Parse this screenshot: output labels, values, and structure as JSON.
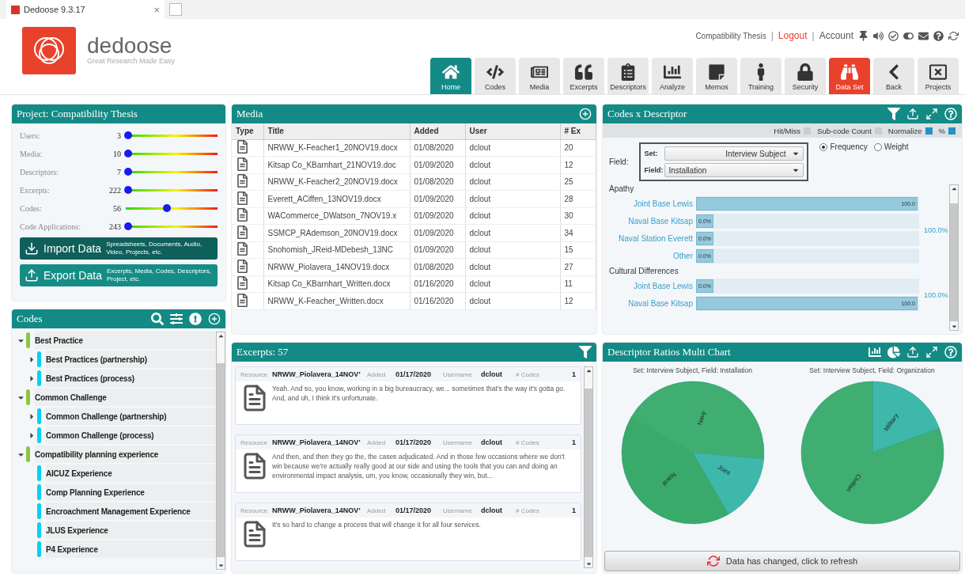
{
  "browser_tab": {
    "title": "Dedoose 9.3.17",
    "close": "×"
  },
  "logo": {
    "name": "dedoose",
    "tagline": "Great Research Made Easy"
  },
  "header_links": [
    {
      "label": "Compatibility Thesis",
      "kind": "text"
    },
    {
      "label": "|",
      "kind": "separator"
    },
    {
      "label": "Logout",
      "kind": "alert"
    },
    {
      "label": "|",
      "kind": "separator"
    },
    {
      "label": "Account",
      "kind": "link"
    }
  ],
  "nav": [
    {
      "label": "Home",
      "selected": true,
      "highlighted": false
    },
    {
      "label": "Codes",
      "selected": false,
      "highlighted": false
    },
    {
      "label": "Media",
      "selected": false,
      "highlighted": false
    },
    {
      "label": "Excerpts",
      "selected": false,
      "highlighted": false
    },
    {
      "label": "Descriptors",
      "selected": false,
      "highlighted": false
    },
    {
      "label": "Analyze",
      "selected": false,
      "highlighted": false
    },
    {
      "label": "Memos",
      "selected": false,
      "highlighted": false
    },
    {
      "label": "Training",
      "selected": false,
      "highlighted": false
    },
    {
      "label": "Security",
      "selected": false,
      "highlighted": false
    },
    {
      "label": "Data Set",
      "selected": false,
      "highlighted": true
    },
    {
      "label": "Back",
      "selected": false,
      "highlighted": false
    },
    {
      "label": "Projects",
      "selected": false,
      "highlighted": false
    }
  ],
  "project": {
    "title": "Project: Compatibility Thesis",
    "stats": [
      {
        "label": "Users:",
        "value": "3",
        "level": 0
      },
      {
        "label": "Media:",
        "value": "10",
        "level": 0
      },
      {
        "label": "Descriptors:",
        "value": "7",
        "level": 0
      },
      {
        "label": "Excerpts:",
        "value": "222",
        "level": 0
      },
      {
        "label": "Codes:",
        "value": "56",
        "level": 0.42
      },
      {
        "label": "Code Applications:",
        "value": "243",
        "level": 0
      }
    ],
    "actions": [
      {
        "label": "Import Data",
        "description": "Spreadsheets, Documents, Audio, Video, Projects, etc.",
        "kind": "import"
      },
      {
        "label": "Export Data",
        "description": "Excerpts, Media, Codes, Descriptors, Project, etc.",
        "kind": "export"
      }
    ]
  },
  "codes": {
    "title": "Codes",
    "tree": [
      {
        "label": "Best Practice",
        "color": "#8dc63f",
        "expanded": true,
        "children": [
          {
            "label": "Best Practices (partnership)",
            "color": "#00d2f0",
            "kind": "group",
            "expanded": false
          },
          {
            "label": "Best Practices (process)",
            "color": "#00d2f0",
            "kind": "group",
            "expanded": false
          }
        ]
      },
      {
        "label": "Common Challenge",
        "color": "#8dc63f",
        "expanded": true,
        "children": [
          {
            "label": "Common Challenge (partnership)",
            "color": "#00d2f0",
            "kind": "group",
            "expanded": false
          },
          {
            "label": "Common Challenge (process)",
            "color": "#00d2f0",
            "kind": "group",
            "expanded": false
          }
        ]
      },
      {
        "label": "Compatibility planning experience",
        "color": "#8dc63f",
        "expanded": true,
        "children": [
          {
            "label": "AICUZ Experience",
            "color": "#00d2f0",
            "kind": "leaf"
          },
          {
            "label": "Comp Planning Experience",
            "color": "#00d2f0",
            "kind": "leaf"
          },
          {
            "label": "Encroachment Management Experience",
            "color": "#00d2f0",
            "kind": "leaf"
          },
          {
            "label": "JLUS Experience",
            "color": "#00d2f0",
            "kind": "leaf"
          },
          {
            "label": "P4 Experience",
            "color": "#00d2f0",
            "kind": "leaf"
          }
        ]
      }
    ]
  },
  "media": {
    "title": "Media",
    "columns": [
      "Type",
      "Title",
      "Added",
      "User",
      "# Ex"
    ],
    "rows": [
      {
        "title": "NRWW_K-Feacher1_20NOV19.docx",
        "added": "01/08/2020",
        "user": "dclout",
        "count": "20"
      },
      {
        "title": "Kitsap Co_KBarnhart_21NOV19.doc",
        "added": "01/09/2020",
        "user": "dclout",
        "count": "12"
      },
      {
        "title": "NRWW_K-Feacher2_20NOV19.docx",
        "added": "01/08/2020",
        "user": "dclout",
        "count": "25"
      },
      {
        "title": "Everett_ACiffen_13NOV19.docx",
        "added": "01/09/2020",
        "user": "dclout",
        "count": "28"
      },
      {
        "title": "WACommerce_DWatson_7NOV19.x",
        "added": "01/09/2020",
        "user": "dclout",
        "count": "30"
      },
      {
        "title": "SSMCP_RAdemson_20NOV19.docx",
        "added": "01/09/2020",
        "user": "dclout",
        "count": "34"
      },
      {
        "title": "Snohomish_JReid-MDebesh_13NC",
        "added": "01/09/2020",
        "user": "dclout",
        "count": "15"
      },
      {
        "title": "NRWW_Piolavera_14NOV19.docx",
        "added": "01/08/2020",
        "user": "dclout",
        "count": "27"
      },
      {
        "title": "Kitsap Co_KBarnhart_Written.docx",
        "added": "01/16/2020",
        "user": "dclout",
        "count": "11"
      },
      {
        "title": "NRWW_K-Feacher_Written.docx",
        "added": "01/16/2020",
        "user": "dclout",
        "count": "12"
      }
    ]
  },
  "excerpts": {
    "title": "Excerpts: 57",
    "items": [
      {
        "resource_label": "Resource",
        "resource": "NRWW_Piolavera_14NOV'",
        "added_label": "Added",
        "added": "01/17/2020",
        "username_label": "Username",
        "username": "dclout",
        "codes_label": "# Codes",
        "codes": "1",
        "text": "Yeah. And so, you know, working in a big bureaucracy, we... sometimes that's the way it's gotta go. And, and uh, I think it's unfortunate."
      },
      {
        "resource_label": "Resource",
        "resource": "NRWW_Piolavera_14NOV'",
        "added_label": "Added",
        "added": "01/17/2020",
        "username_label": "Username",
        "username": "dclout",
        "codes_label": "# Codes",
        "codes": "1",
        "text": "And then, and then they go the, the cases adjudicated. And in those few occasions where we don't win because we're actually really good at our side and using the tools that you can and doing an environmental impact analysis, um, you know, occasionally they win, but..."
      },
      {
        "resource_label": "Resource",
        "resource": "NRWW_Piolavera_14NOV'",
        "added_label": "Added",
        "added": "01/17/2020",
        "username_label": "Username",
        "username": "dclout",
        "codes_label": "# Codes",
        "codes": "1",
        "text": "It's so hard to change a process that will change it for all four services."
      }
    ]
  },
  "codes_x_descriptor": {
    "title": "Codes x Descriptor",
    "options": [
      {
        "label": "Hit/Miss",
        "checked": false
      },
      {
        "label": "Sub-code Count",
        "checked": false
      },
      {
        "label": "Normalize",
        "checked": true
      },
      {
        "label": "%",
        "checked": true
      }
    ],
    "field_label": "Field:",
    "set": {
      "label": "Set:",
      "value": "Interview Subject"
    },
    "field": {
      "label": "Field:",
      "value": "Installation"
    },
    "radios": [
      {
        "label": "Frequency",
        "selected": true
      },
      {
        "label": "Weight",
        "selected": false
      }
    ],
    "groups": [
      {
        "name": "Apathy",
        "total": "100.0%",
        "bars": [
          {
            "label": "Joint Base Lewis",
            "value": "100.0",
            "level": 1
          },
          {
            "label": "Naval Base Kitsap",
            "value": "0.0%",
            "level": 0
          },
          {
            "label": "Naval Station Everett",
            "value": "0.0%",
            "level": 0
          },
          {
            "label": "Other",
            "value": "0.0%",
            "level": 0
          }
        ]
      },
      {
        "name": "Cultural Differences",
        "total": "100.0%",
        "bars": [
          {
            "label": "Joint Base Lewis",
            "value": "0.0%",
            "level": 0
          },
          {
            "label": "Naval Base Kitsap",
            "value": "100.0",
            "level": 1
          }
        ]
      }
    ]
  },
  "ratios": {
    "title": "Descriptor Ratios Multi Chart",
    "pies": [
      {
        "title": "Set: Interview Subject, Field: Installation",
        "slices": [
          {
            "label": "Navy",
            "color": "#3fae70"
          },
          {
            "label": "Joint",
            "color": "#3fb8ac"
          },
          {
            "label": "Naval",
            "color": "#3aaa6a"
          }
        ]
      },
      {
        "title": "Set: Interview Subject, Field: Organization",
        "slices": [
          {
            "label": "Military",
            "color": "#3fb8ac"
          },
          {
            "label": "Civilian",
            "color": "#3fae70"
          }
        ]
      }
    ],
    "refresh": "Data has changed, click to refresh"
  }
}
